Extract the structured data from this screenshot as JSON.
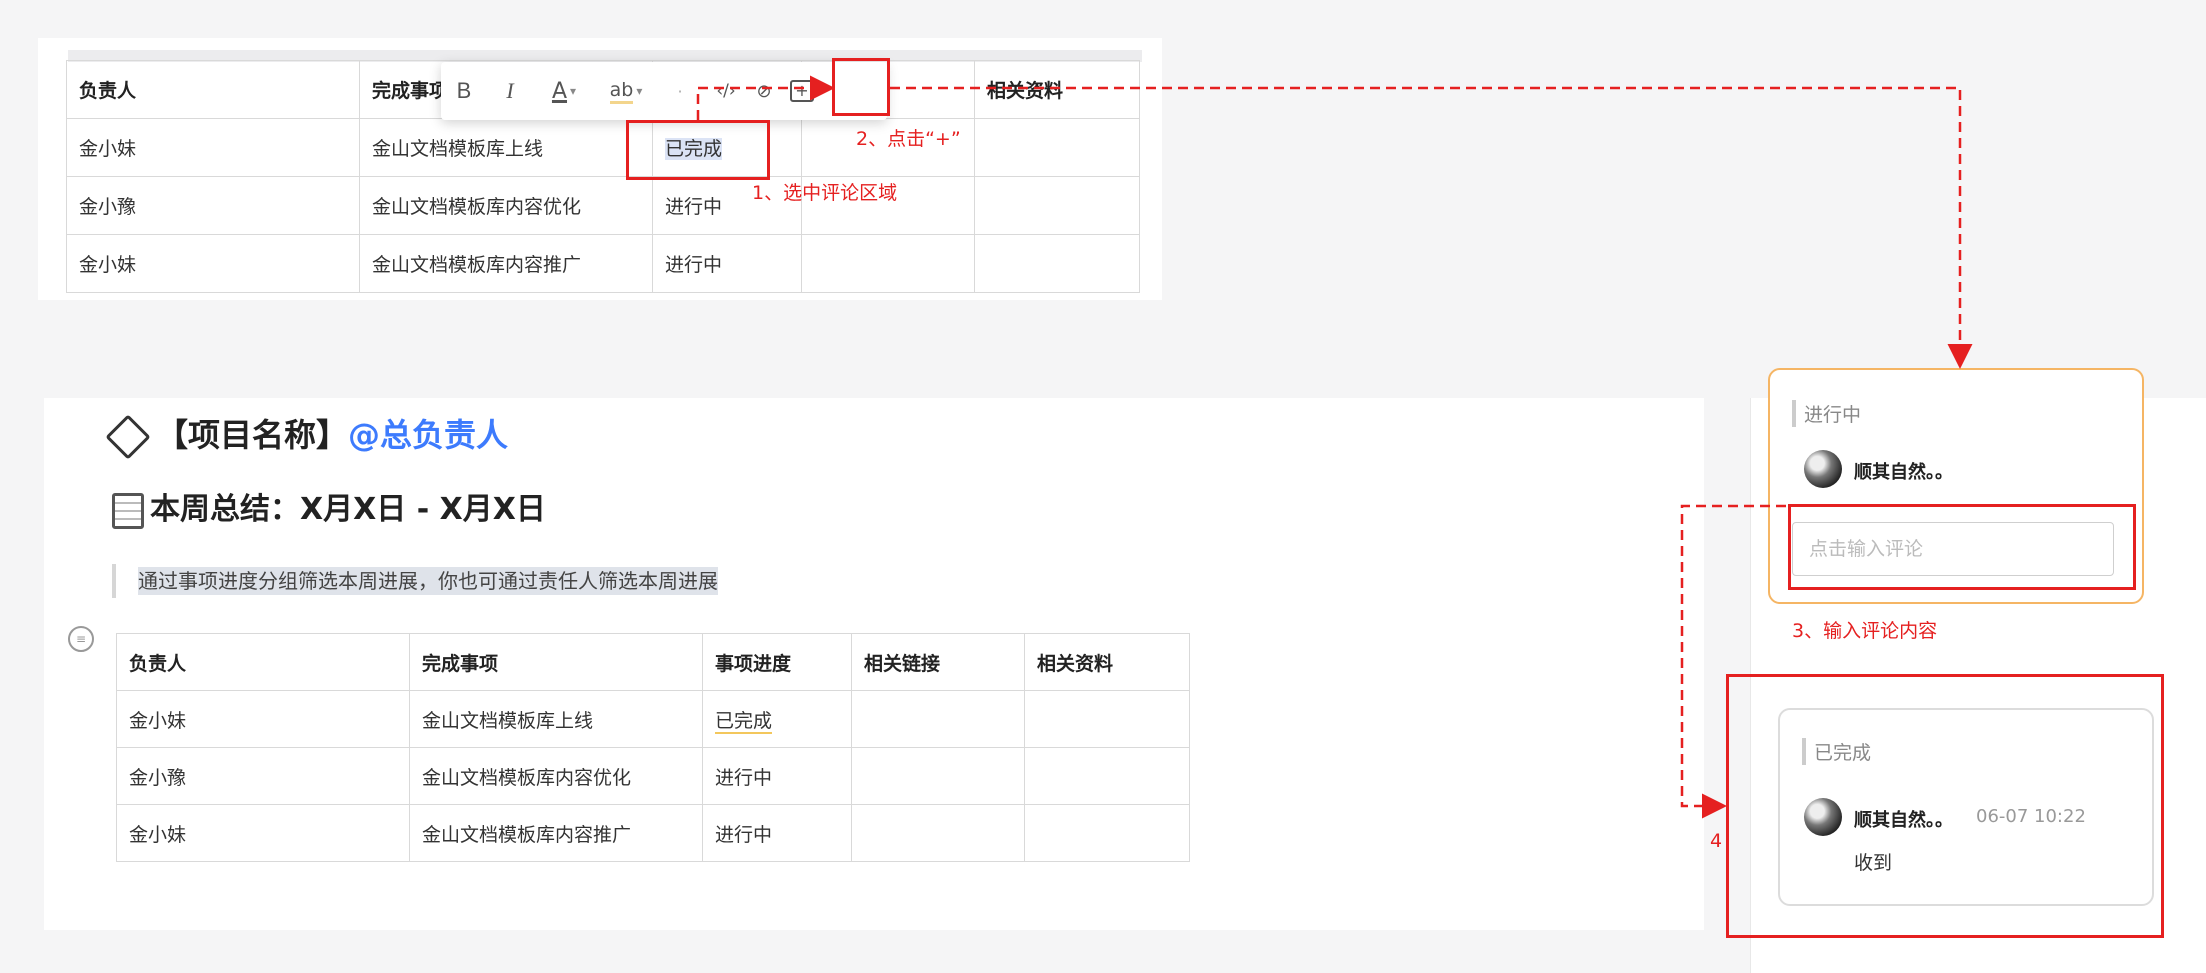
{
  "top_doc": {
    "table": {
      "headers": [
        "负责人",
        "完成事项",
        "",
        "",
        "相关资料"
      ],
      "rows": [
        [
          "金小妹",
          "金山文档模板库上线",
          "已完成",
          "",
          ""
        ],
        [
          "金小豫",
          "金山文档模板库内容优化",
          "进行中",
          "",
          ""
        ],
        [
          "金小妹",
          "金山文档模板库内容推广",
          "进行中",
          "",
          ""
        ]
      ]
    },
    "toolbar": {
      "bold": "B",
      "italic": "I",
      "font_color": "A",
      "highlight": "ab",
      "code": "‹/›",
      "link": "⊘",
      "comment": "+"
    }
  },
  "bottom_doc": {
    "title_prefix": "【项目名称】",
    "title_mention": "@总负责人",
    "week_heading": "本周总结：X月X日 - X月X日",
    "quote": "通过事项进度分组筛选本周进展，你也可通过责任人筛选本周进展",
    "table": {
      "headers": [
        "负责人",
        "完成事项",
        "事项进度",
        "相关链接",
        "相关资料"
      ],
      "rows": [
        [
          "金小妹",
          "金山文档模板库上线",
          "已完成",
          "",
          ""
        ],
        [
          "金小豫",
          "金山文档模板库内容优化",
          "进行中",
          "",
          ""
        ],
        [
          "金小妹",
          "金山文档模板库内容推广",
          "进行中",
          "",
          ""
        ]
      ]
    }
  },
  "comment_card_1": {
    "quote": "进行中",
    "user": "顺其自然。。",
    "input_placeholder": "点击输入评论"
  },
  "comment_card_2": {
    "quote": "已完成",
    "user": "顺其自然。。",
    "time": "06-07 10:22",
    "text": "收到"
  },
  "annotations": {
    "step1": "1、选中评论区域",
    "step2": "2、点击“+”",
    "step3": "3、输入评论内容",
    "step4": "4"
  },
  "colors": {
    "annotation": "#e52020",
    "mention": "#3d7bfd",
    "card_active_border": "#f5b564"
  }
}
